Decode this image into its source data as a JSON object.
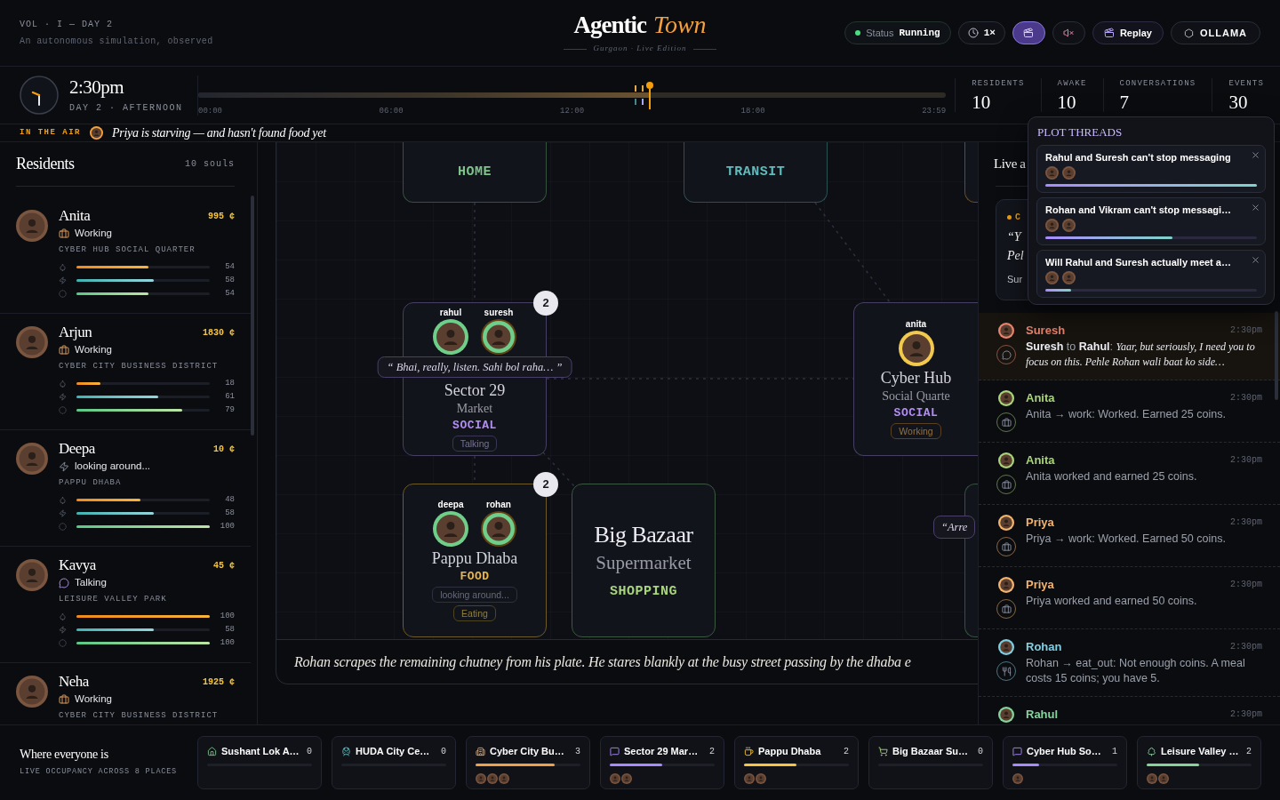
{
  "masthead": {
    "volume": "VOL · I — DAY 2",
    "tagline": "An autonomous simulation, observed",
    "title": "Agentic",
    "title_accent": "Town",
    "edition": "Gurgaon · Live Edition"
  },
  "controls": [
    {
      "kind": "status",
      "label": "Status",
      "value": "Running"
    },
    {
      "kind": "speed",
      "label": "1×"
    },
    {
      "kind": "scene",
      "on": true
    },
    {
      "kind": "sound",
      "muted": true
    },
    {
      "kind": "replay",
      "label": "Replay"
    },
    {
      "kind": "model",
      "label": "OLLAMA"
    }
  ],
  "clock": {
    "time": "2:30pm",
    "day": "DAY 2 · AFTERNOON",
    "timeline": {
      "level": 0.604,
      "ticks": [
        "00:00",
        "06:00",
        "12:00",
        "18:00",
        "23:59"
      ]
    }
  },
  "stats": [
    {
      "label": "RESIDENTS",
      "value": "10"
    },
    {
      "label": "AWAKE",
      "value": "10"
    },
    {
      "label": "CONVERSATIONS",
      "value": "7"
    },
    {
      "label": "EVENTS",
      "value": "30"
    }
  ],
  "ticker": {
    "label": "IN THE AIR",
    "text": "Priya is starving — and hasn't found food yet"
  },
  "residents": {
    "title": "Residents",
    "count": "10 souls",
    "items": [
      {
        "name": "Anita",
        "coins": "995 ¢",
        "status": {
          "kind": "working",
          "text": "Working"
        },
        "location": "CYBER HUB SOCIAL QUARTER",
        "needs": [
          {
            "kind": "hunger",
            "level": 0.54,
            "reading": "54"
          },
          {
            "kind": "energy",
            "level": 0.58,
            "reading": "58"
          },
          {
            "kind": "mood",
            "level": 0.54,
            "reading": "54"
          }
        ]
      },
      {
        "name": "Arjun",
        "coins": "1830 ¢",
        "status": {
          "kind": "working",
          "text": "Working"
        },
        "location": "CYBER CITY BUSINESS DISTRICT",
        "needs": [
          {
            "kind": "hunger",
            "level": 0.18,
            "reading": "18"
          },
          {
            "kind": "energy",
            "level": 0.61,
            "reading": "61"
          },
          {
            "kind": "mood",
            "level": 0.79,
            "reading": "79"
          }
        ]
      },
      {
        "name": "Deepa",
        "coins": "10 ¢",
        "status": {
          "kind": "idle",
          "text": "looking around..."
        },
        "location": "PAPPU DHABA",
        "needs": [
          {
            "kind": "hunger",
            "level": 0.48,
            "reading": "48"
          },
          {
            "kind": "energy",
            "level": 0.58,
            "reading": "58"
          },
          {
            "kind": "mood",
            "level": 1,
            "reading": "100"
          }
        ]
      },
      {
        "name": "Kavya",
        "coins": "45 ¢",
        "status": {
          "kind": "talking",
          "text": "Talking"
        },
        "location": "LEISURE VALLEY PARK",
        "needs": [
          {
            "kind": "hunger",
            "level": 1,
            "reading": "100"
          },
          {
            "kind": "energy",
            "level": 0.58,
            "reading": "58"
          },
          {
            "kind": "mood",
            "level": 1,
            "reading": "100"
          }
        ]
      },
      {
        "name": "Neha",
        "coins": "1925 ¢",
        "status": {
          "kind": "working",
          "text": "Working"
        },
        "location": "CYBER CITY BUSINESS DISTRICT"
      }
    ]
  },
  "map": {
    "nodes": [
      {
        "kind": "home",
        "category": "HOME"
      },
      {
        "kind": "transit",
        "category": "TRANSIT"
      },
      {
        "kind": "work"
      },
      {
        "kind": "social",
        "title": "Sector 29",
        "subtitle": "Market",
        "category": "SOCIAL",
        "count": "2",
        "agents": [
          {
            "name": "rahul",
            "color": "#6fcf8a",
            "highlighted": false
          },
          {
            "name": "suresh",
            "color": "#6fcf8a",
            "highlighted": true
          }
        ],
        "bubble": "“ Bhai, really, listen. Sahi bol raha… ”",
        "statuses": [
          {
            "kind": "talking",
            "text": "Talking"
          }
        ]
      },
      {
        "kind": "social",
        "title": "Cyber Hub",
        "subtitle": "Social Quarte",
        "category": "SOCIAL",
        "agents": [
          {
            "name": "anita",
            "color": "#f2c94c",
            "highlighted": false
          }
        ],
        "statuses": [
          {
            "kind": "working",
            "text": "Working"
          }
        ]
      },
      {
        "kind": "food",
        "title": "Pappu Dhaba",
        "category": "FOOD",
        "count": "2",
        "agents": [
          {
            "name": "deepa",
            "color": "#6fcf8a",
            "highlighted": false
          },
          {
            "name": "rohan",
            "color": "#6fcf8a",
            "highlighted": true
          }
        ],
        "statuses": [
          {
            "kind": "idle",
            "text": "looking around..."
          },
          {
            "kind": "eating",
            "text": "Eating"
          }
        ]
      },
      {
        "kind": "shopping",
        "title": "Big Bazaar",
        "subtitle": "Supermarket",
        "category": "SHOPPING"
      },
      {
        "kind": "park",
        "bubble": "“Arre"
      }
    ],
    "narration": "Rohan scrapes the remaining chutney from his plate. He stares blankly at the busy street passing by the dhaba e"
  },
  "activity": {
    "title": "Live a",
    "featured": {
      "label": "C",
      "quote_lines": [
        "“Y",
        "Pel"
      ],
      "speaker": "Sur"
    },
    "items": [
      {
        "kind": "chat",
        "name": "Suresh",
        "color": "#e8846f",
        "time": "2:30pm",
        "text": "**Suresh** to **Rahul**: *Yaar, but seriously, I need you to focus on this. Pehle Rohan wali baat ko side…*",
        "highlighted": true
      },
      {
        "kind": "work",
        "name": "Anita",
        "color": "#a9d47a",
        "time": "2:30pm",
        "text": "Anita → work: Worked. Earned 25 coins.",
        "highlighted": false
      },
      {
        "kind": "work",
        "name": "Anita",
        "color": "#a9d47a",
        "time": "2:30pm",
        "text": "Anita worked and earned 25 coins.",
        "highlighted": false
      },
      {
        "kind": "work",
        "name": "Priya",
        "color": "#f2b46d",
        "time": "2:30pm",
        "text": "Priya → work: Worked. Earned 50 coins.",
        "highlighted": false
      },
      {
        "kind": "work",
        "name": "Priya",
        "color": "#f2b46d",
        "time": "2:30pm",
        "text": "Priya worked and earned 50 coins.",
        "highlighted": false
      },
      {
        "kind": "eat",
        "name": "Rohan",
        "color": "#7fcfe3",
        "time": "2:30pm",
        "text": "Rohan → eat_out: Not enough coins. A meal costs 15 coins; you have 5.",
        "highlighted": false
      },
      {
        "name": "Rahul",
        "color": "#84d49c",
        "time": "2:30pm",
        "highlighted": false
      }
    ]
  },
  "plot_threads": {
    "title": "PLOT THREADS",
    "threads": [
      {
        "title": "Rahul and Suresh can't stop messaging",
        "level": 1
      },
      {
        "title": "Rohan and Vikram can't stop messagi…",
        "level": 0.6
      },
      {
        "title": "Will Rahul and Suresh actually meet a…",
        "level": 0.12
      }
    ]
  },
  "occupancy": {
    "title": "Where everyone is",
    "subtitle": "LIVE OCCUPANCY ACROSS 8 PLACES",
    "places": [
      {
        "kind": "home",
        "name": "Sushant Lok A…",
        "count": "0"
      },
      {
        "kind": "transit",
        "name": "HUDA City Ce…",
        "count": "0"
      },
      {
        "kind": "work",
        "name": "Cyber City Bu…",
        "count": "3",
        "level": 0.75
      },
      {
        "kind": "social",
        "name": "Sector 29 Mar…",
        "count": "2",
        "level": 0.5
      },
      {
        "kind": "food",
        "name": "Pappu Dhaba",
        "count": "2",
        "level": 0.5
      },
      {
        "kind": "shopping",
        "name": "Big Bazaar Su…",
        "count": "0"
      },
      {
        "kind": "social",
        "name": "Cyber Hub So…",
        "count": "1",
        "level": 0.25
      },
      {
        "kind": "park",
        "name": "Leisure Valley …",
        "count": "2",
        "level": 0.5
      }
    ]
  }
}
